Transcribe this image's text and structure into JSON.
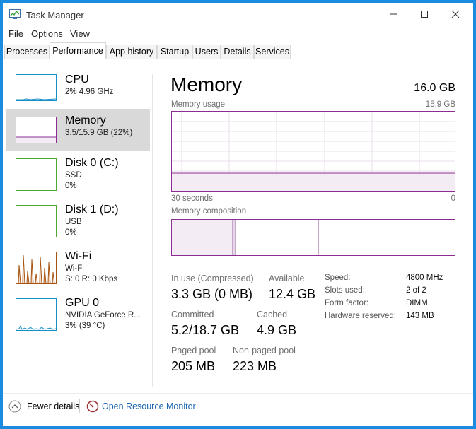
{
  "window": {
    "title": "Task Manager",
    "controls": {
      "minimize": "—",
      "maximize": "☐",
      "close": "✕"
    }
  },
  "menu": [
    "File",
    "Options",
    "View"
  ],
  "tabs": [
    {
      "label": "Processes",
      "active": false
    },
    {
      "label": "Performance",
      "active": true
    },
    {
      "label": "App history",
      "active": false
    },
    {
      "label": "Startup",
      "active": false
    },
    {
      "label": "Users",
      "active": false
    },
    {
      "label": "Details",
      "active": false
    },
    {
      "label": "Services",
      "active": false
    }
  ],
  "sidebar": [
    {
      "name": "CPU",
      "lines": [
        "2% 4.96 GHz"
      ],
      "selected": false,
      "color": "#1790c8"
    },
    {
      "name": "Memory",
      "lines": [
        "3.5/15.9 GB (22%)"
      ],
      "selected": true,
      "color": "#8b2e91"
    },
    {
      "name": "Disk 0 (C:)",
      "lines": [
        "SSD",
        "0%"
      ],
      "selected": false,
      "color": "#4ea72e"
    },
    {
      "name": "Disk 1 (D:)",
      "lines": [
        "USB",
        "0%"
      ],
      "selected": false,
      "color": "#4ea72e"
    },
    {
      "name": "Wi-Fi",
      "lines": [
        "Wi-Fi",
        "S: 0 R: 0 Kbps"
      ],
      "selected": false,
      "color": "#a7530f"
    },
    {
      "name": "GPU 0",
      "lines": [
        "NVIDIA GeForce R...",
        "3% (39 °C)"
      ],
      "selected": false,
      "color": "#1790c8"
    }
  ],
  "main": {
    "title": "Memory",
    "total": "16.0 GB",
    "usage_label": "Memory usage",
    "usage_max": "15.9 GB",
    "axis_left": "30 seconds",
    "axis_right": "0",
    "composition_label": "Memory composition",
    "stats": {
      "in_use_label": "In use (Compressed)",
      "in_use_value": "3.3 GB (0 MB)",
      "available_label": "Available",
      "available_value": "12.4 GB",
      "committed_label": "Committed",
      "committed_value": "5.2/18.7 GB",
      "cached_label": "Cached",
      "cached_value": "4.9 GB",
      "paged_label": "Paged pool",
      "paged_value": "205 MB",
      "nonpaged_label": "Non-paged pool",
      "nonpaged_value": "223 MB"
    },
    "specs": [
      {
        "label": "Speed:",
        "value": "4800 MHz"
      },
      {
        "label": "Slots used:",
        "value": "2 of 2"
      },
      {
        "label": "Form factor:",
        "value": "DIMM"
      },
      {
        "label": "Hardware reserved:",
        "value": "143 MB"
      }
    ]
  },
  "footer": {
    "fewer_details": "Fewer details",
    "open_monitor": "Open Resource Monitor"
  },
  "colors": {
    "memory": "#8b2e91",
    "cpu": "#1790c8",
    "disk": "#4ea72e",
    "wifi": "#a7530f",
    "window_border": "#1a8ce0",
    "link": "#1a64b0"
  },
  "memory_usage_fraction": 0.22
}
